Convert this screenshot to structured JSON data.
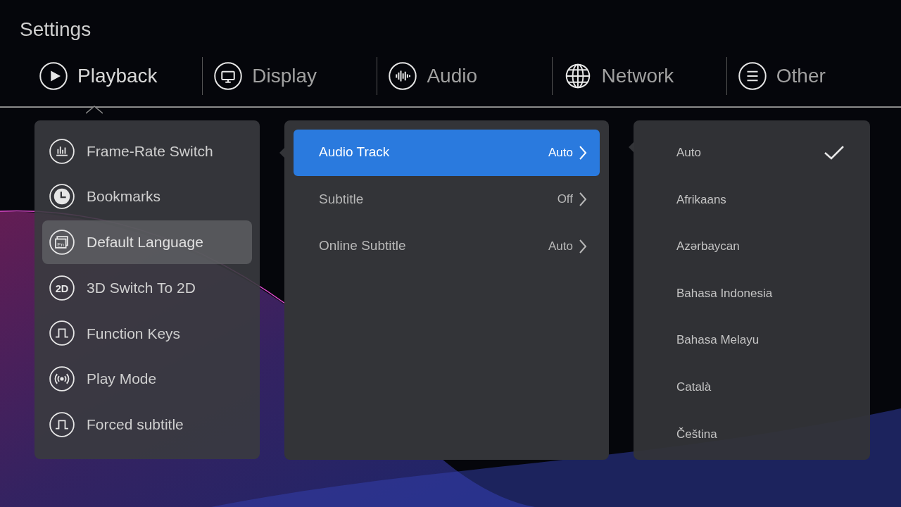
{
  "title": "Settings",
  "tabs": [
    {
      "label": "Playback",
      "kind": "play",
      "selected": true
    },
    {
      "label": "Display",
      "kind": "monitor",
      "selected": false
    },
    {
      "label": "Audio",
      "kind": "wave",
      "selected": false
    },
    {
      "label": "Network",
      "kind": "globe",
      "selected": false
    },
    {
      "label": "Other",
      "kind": "list",
      "selected": false
    }
  ],
  "categories": [
    {
      "label": "Frame-Rate Switch",
      "kind": "bars",
      "selected": false
    },
    {
      "label": "Bookmarks",
      "kind": "clock",
      "selected": false
    },
    {
      "label": "Default Language",
      "kind": "lang",
      "icon_text": "En",
      "selected": true
    },
    {
      "label": "3D Switch To 2D",
      "kind": "badge",
      "icon_text": "2D",
      "selected": false
    },
    {
      "label": "Function Keys",
      "kind": "pulse",
      "selected": false
    },
    {
      "label": "Play Mode",
      "kind": "broadcast",
      "selected": false
    },
    {
      "label": "Forced subtitle",
      "kind": "pulse",
      "selected": false
    }
  ],
  "options": [
    {
      "label": "Audio Track",
      "value": "Auto",
      "selected": true
    },
    {
      "label": "Subtitle",
      "value": "Off",
      "selected": false
    },
    {
      "label": "Online Subtitle",
      "value": "Auto",
      "selected": false
    }
  ],
  "choices": [
    {
      "label": "Auto",
      "checked": true
    },
    {
      "label": "Afrikaans",
      "checked": false
    },
    {
      "label": "Azərbaycan",
      "checked": false
    },
    {
      "label": "Bahasa Indonesia",
      "checked": false
    },
    {
      "label": "Bahasa Melayu",
      "checked": false
    },
    {
      "label": "Català",
      "checked": false
    },
    {
      "label": "Čeština",
      "checked": false
    }
  ]
}
